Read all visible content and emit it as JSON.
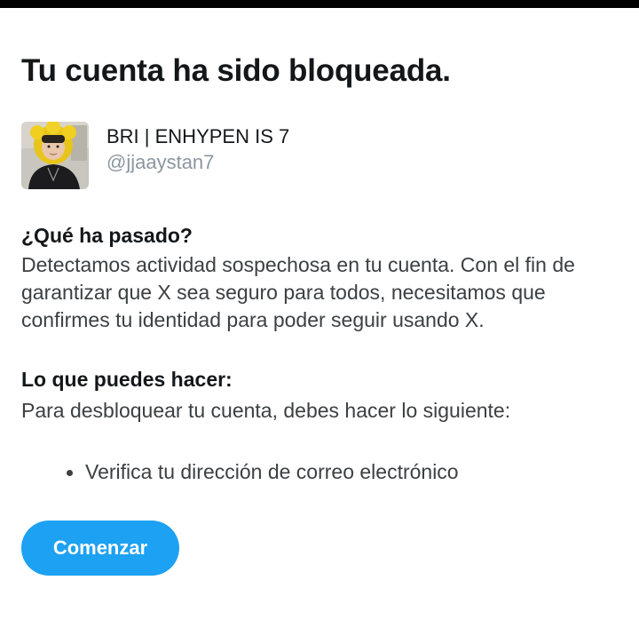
{
  "page": {
    "title": "Tu cuenta ha sido bloqueada."
  },
  "account": {
    "avatar_icon": "user-photo-avatar",
    "display_name": "BRI | ENHYPEN IS 7",
    "handle": "@jjaaystan7"
  },
  "what_happened": {
    "heading": "¿Qué ha pasado?",
    "body": "Detectamos actividad sospechosa en tu cuenta. Con el fin de garantizar que X sea seguro para todos, necesitamos que confirmes tu identidad para poder seguir usando X."
  },
  "what_to_do": {
    "heading": "Lo que puedes hacer:",
    "body": "Para desbloquear tu cuenta, debes hacer lo siguiente:",
    "steps": [
      "Verifica tu dirección de correo electrónico"
    ]
  },
  "actions": {
    "start_label": "Comenzar"
  },
  "colors": {
    "accent": "#1da1f2",
    "text_primary": "#14171a",
    "text_secondary": "#3c4043",
    "handle": "#8c96a0",
    "top_bar": "#000000"
  }
}
